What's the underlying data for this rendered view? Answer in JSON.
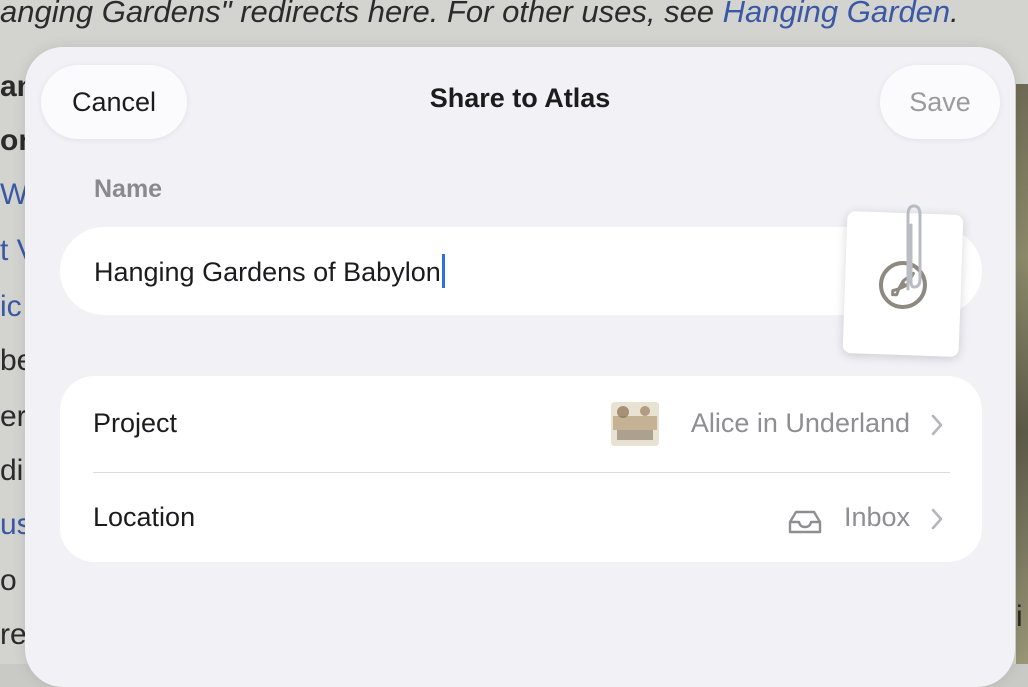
{
  "background": {
    "hatnote_prefix": "anging Gardens\" redirects here. For other uses, see ",
    "hatnote_link": "Hanging Garden",
    "hatnote_suffix": "."
  },
  "sheet": {
    "title": "Share to Atlas",
    "cancel_label": "Cancel",
    "save_label": "Save",
    "name_label": "Name",
    "name_value": "Hanging Gardens of Babylon",
    "rows": [
      {
        "label": "Project",
        "value": "Alice in Underland"
      },
      {
        "label": "Location",
        "value": "Inbox"
      }
    ]
  },
  "colors": {
    "accent_caret": "#2f6fe4",
    "link": "#3a58a4",
    "sheet_bg": "#f1f1f6"
  },
  "icons": [
    "compass-pen-icon",
    "paperclip-icon",
    "inbox-icon",
    "chevron-right-icon"
  ]
}
